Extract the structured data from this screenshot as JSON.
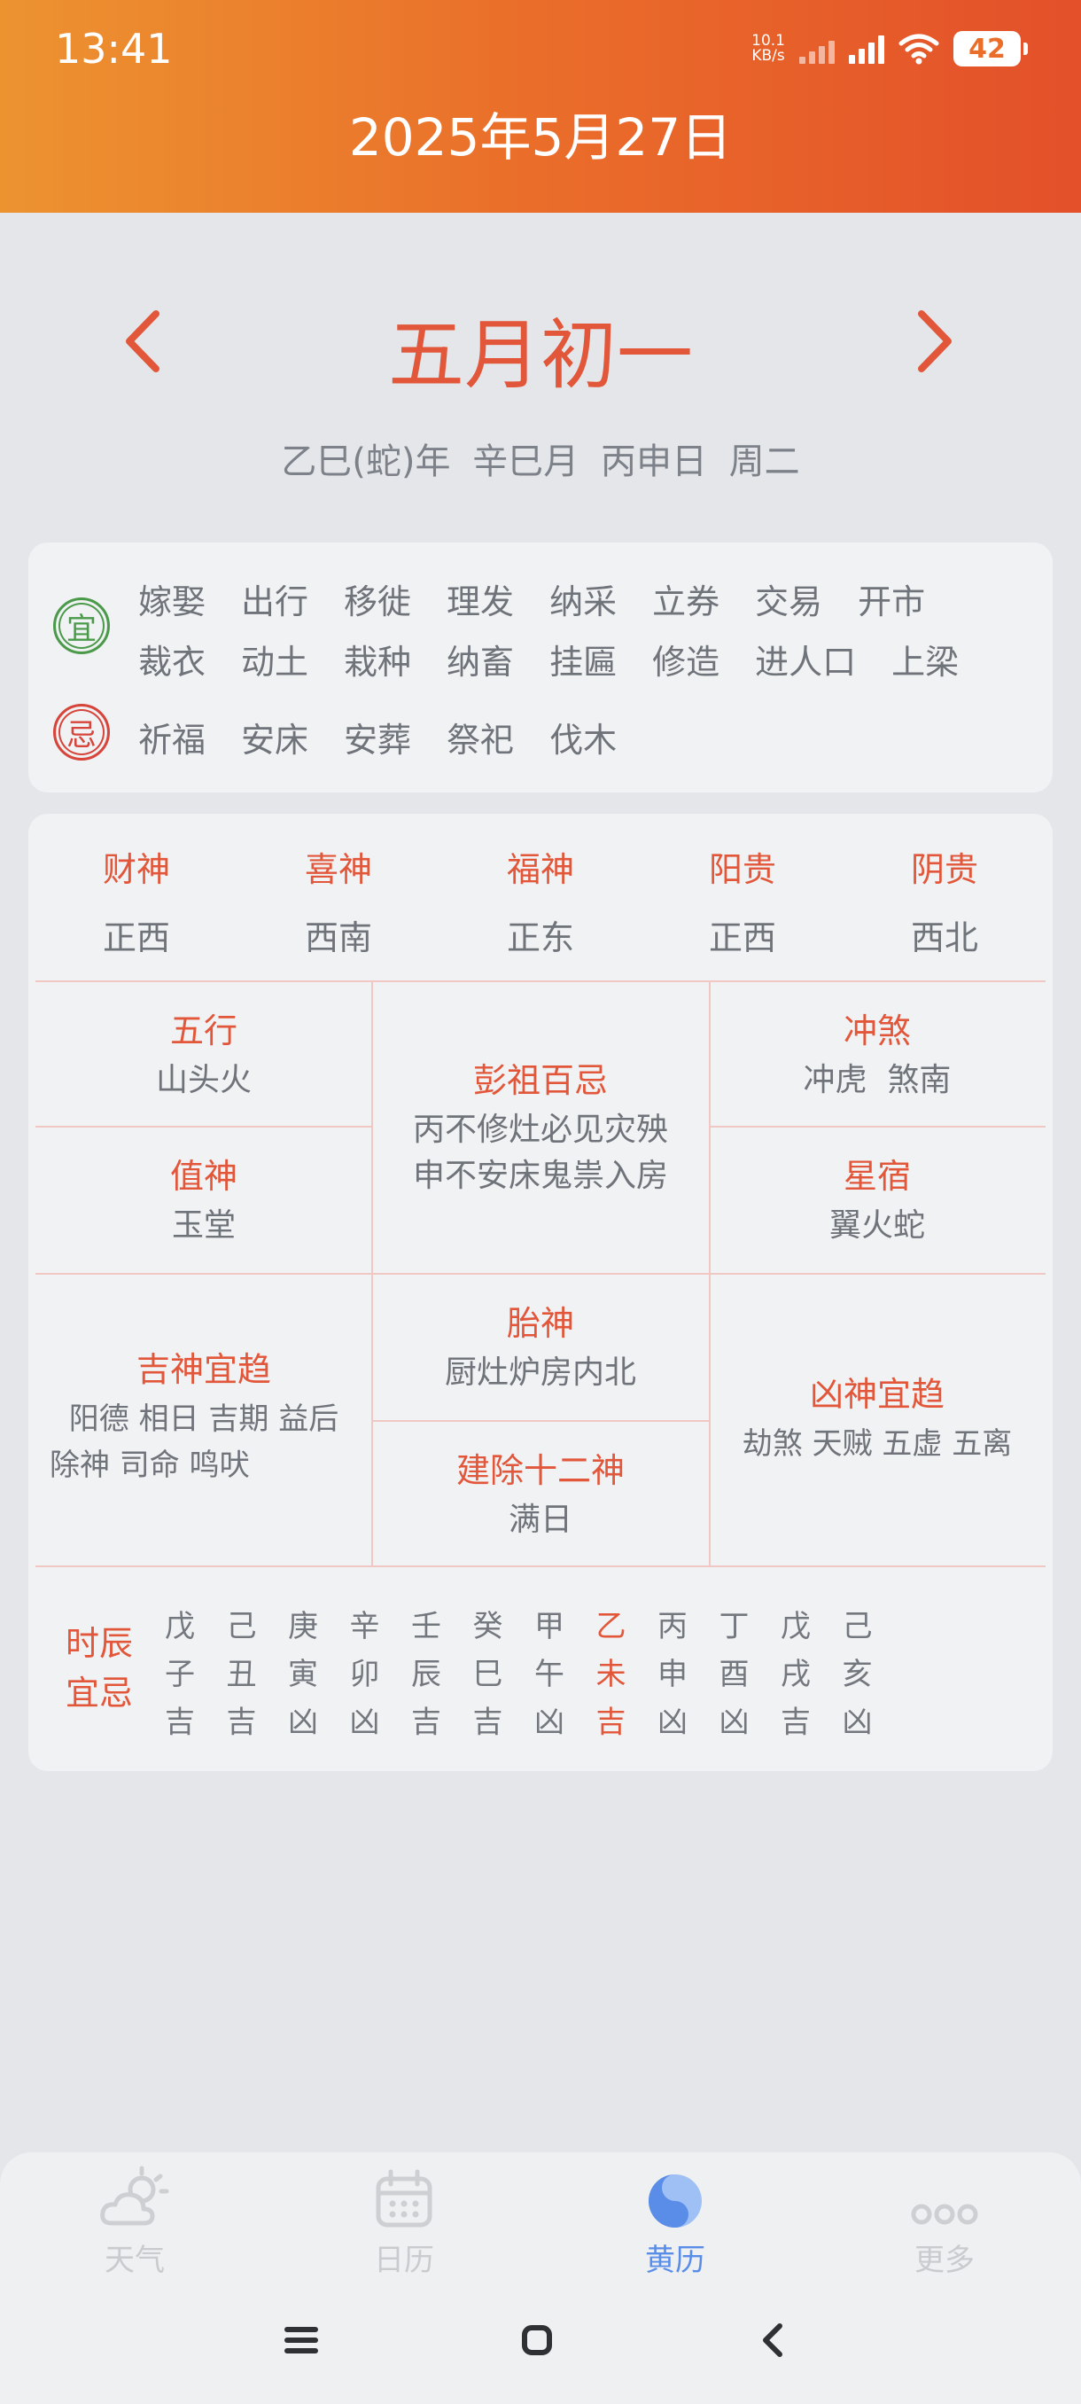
{
  "status_bar": {
    "time": "13:41",
    "net_speed_value": "10.1",
    "net_speed_unit": "KB/s",
    "battery": "42"
  },
  "header": {
    "date": "2025年5月27日"
  },
  "lunar": {
    "title": "五月初一",
    "ganzhi": [
      "乙巳(蛇)年",
      "辛巳月",
      "丙申日",
      "周二"
    ]
  },
  "yiji": {
    "yi_badge": "宜",
    "ji_badge": "忌",
    "yi_row1": [
      "嫁娶",
      "出行",
      "移徙",
      "理发",
      "纳采",
      "立券",
      "交易",
      "开市"
    ],
    "yi_row2": [
      "裁衣",
      "动土",
      "栽种",
      "纳畜",
      "挂匾",
      "修造",
      "进人口",
      "上梁"
    ],
    "ji": [
      "祈福",
      "安床",
      "安葬",
      "祭祀",
      "伐木"
    ]
  },
  "gods": [
    {
      "label": "财神",
      "value": "正西"
    },
    {
      "label": "喜神",
      "value": "西南"
    },
    {
      "label": "福神",
      "value": "正东"
    },
    {
      "label": "阳贵",
      "value": "正西"
    },
    {
      "label": "阴贵",
      "value": "西北"
    }
  ],
  "details": {
    "wuxing": {
      "label": "五行",
      "value": "山头火"
    },
    "pengzu": {
      "label": "彭祖百忌",
      "line1": "丙不修灶必见灾殃",
      "line2": "申不安床鬼祟入房"
    },
    "chongsha": {
      "label": "冲煞",
      "value": "冲虎  煞南"
    },
    "zhishen": {
      "label": "值神",
      "value": "玉堂"
    },
    "xingxiu": {
      "label": "星宿",
      "value": "翼火蛇"
    },
    "taishen": {
      "label": "胎神",
      "value": "厨灶炉房内北"
    },
    "jishen": {
      "label": "吉神宜趋",
      "line1": "阳德 相日 吉期 益后",
      "line2": "除神 司命 鸣吠"
    },
    "jianchu": {
      "label": "建除十二神",
      "value": "满日"
    },
    "xiongshen": {
      "label": "凶神宜趋",
      "value": "劫煞 天贼 五虚 五离"
    }
  },
  "hours": {
    "label_line1": "时辰",
    "label_line2": "宜忌",
    "active_index": 7,
    "items": [
      {
        "stem": "戊",
        "branch": "子",
        "luck": "吉"
      },
      {
        "stem": "己",
        "branch": "丑",
        "luck": "吉"
      },
      {
        "stem": "庚",
        "branch": "寅",
        "luck": "凶"
      },
      {
        "stem": "辛",
        "branch": "卯",
        "luck": "凶"
      },
      {
        "stem": "壬",
        "branch": "辰",
        "luck": "吉"
      },
      {
        "stem": "癸",
        "branch": "巳",
        "luck": "吉"
      },
      {
        "stem": "甲",
        "branch": "午",
        "luck": "凶"
      },
      {
        "stem": "乙",
        "branch": "未",
        "luck": "吉"
      },
      {
        "stem": "丙",
        "branch": "申",
        "luck": "凶"
      },
      {
        "stem": "丁",
        "branch": "酉",
        "luck": "凶"
      },
      {
        "stem": "戊",
        "branch": "戌",
        "luck": "吉"
      },
      {
        "stem": "己",
        "branch": "亥",
        "luck": "凶"
      }
    ]
  },
  "bottom_nav": {
    "items": [
      {
        "label": "天气",
        "icon": "weather-icon"
      },
      {
        "label": "日历",
        "icon": "calendar-icon"
      },
      {
        "label": "黄历",
        "icon": "yin-yang-icon"
      },
      {
        "label": "更多",
        "icon": "more-icon"
      }
    ],
    "active_index": 2
  },
  "colors": {
    "accent": "#e2563a",
    "active_tab": "#5a8de8",
    "yi": "#4a9a4a",
    "ji": "#d6443a"
  }
}
